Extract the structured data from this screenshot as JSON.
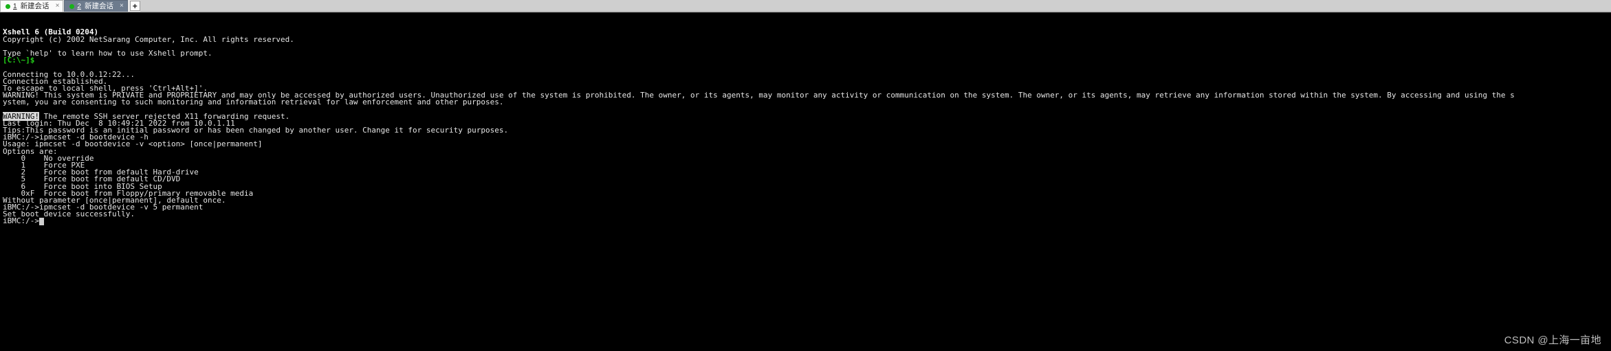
{
  "window": {
    "app_name": "Xshell 6"
  },
  "tabbar": {
    "tabs": [
      {
        "number": "1",
        "label": "新建会话",
        "close_icon": "×",
        "status_icon": "green-dot",
        "active": false
      },
      {
        "number": "2",
        "label": "新建会话",
        "close_icon": "×",
        "status_icon": "green-dot",
        "active": true
      }
    ],
    "new_tab_label": "+"
  },
  "terminal": {
    "lines": [
      {
        "text": "Xshell 6 (Build 0204)",
        "style": "bold"
      },
      {
        "text": "Copyright (c) 2002 NetSarang Computer, Inc. All rights reserved.",
        "style": "plain"
      },
      {
        "text": "",
        "style": "blank"
      },
      {
        "text": "Type `help' to learn how to use Xshell prompt.",
        "style": "plain"
      },
      {
        "text": "[C:\\~]$",
        "style": "green"
      },
      {
        "text": "",
        "style": "blank"
      },
      {
        "text": "Connecting to 10.0.0.12:22...",
        "style": "plain"
      },
      {
        "text": "Connection established.",
        "style": "plain"
      },
      {
        "text": "To escape to local shell, press 'Ctrl+Alt+]'.",
        "style": "plain"
      },
      {
        "text": "WARNING! This system is PRIVATE and PROPRIETARY and may only be accessed by authorized users. Unauthorized use of the system is prohibited. The owner, or its agents, may monitor any activity or communication on the system. The owner, or its agents, may retrieve any information stored within the system. By accessing and using the s",
        "style": "plain"
      },
      {
        "text": "ystem, you are consenting to such monitoring and information retrieval for law enforcement and other purposes.",
        "style": "plain"
      },
      {
        "text": "",
        "style": "blank"
      },
      {
        "text": "WARNING!",
        "style": "inverse-prefix",
        "rest": " The remote SSH server rejected X11 forwarding request."
      },
      {
        "text": "Last login: Thu Dec  8 10:49:21 2022 from 10.0.1.11",
        "style": "plain"
      },
      {
        "text": "Tips:This password is an initial password or has been changed by another user. Change it for security purposes.",
        "style": "plain"
      },
      {
        "text": "iBMC:/->ipmcset -d bootdevice -h",
        "style": "plain"
      },
      {
        "text": "Usage: ipmcset -d bootdevice -v <option> [once|permanent]",
        "style": "plain"
      },
      {
        "text": "Options are:",
        "style": "plain"
      },
      {
        "text": "    0    No override",
        "style": "plain"
      },
      {
        "text": "    1    Force PXE",
        "style": "plain"
      },
      {
        "text": "    2    Force boot from default Hard-drive",
        "style": "plain"
      },
      {
        "text": "    5    Force boot from default CD/DVD",
        "style": "plain"
      },
      {
        "text": "    6    Force boot into BIOS Setup",
        "style": "plain"
      },
      {
        "text": "    0xF  Force boot from Floppy/primary removable media",
        "style": "plain"
      },
      {
        "text": "Without parameter [once|permanent], default once.",
        "style": "plain"
      },
      {
        "text": "iBMC:/->ipmcset -d bootdevice -v 5 permanent",
        "style": "plain"
      },
      {
        "text": "Set boot device successfully.",
        "style": "plain"
      },
      {
        "text": "iBMC:/->",
        "style": "prompt-cursor"
      }
    ]
  },
  "watermark": {
    "text": "CSDN @上海一亩地"
  },
  "colors": {
    "terminal_background": "#000000",
    "terminal_foreground": "#e5e5e5",
    "prompt_green": "#23d018",
    "tab_active_background": "#6d7b8d",
    "tab_status_dot": "#18b218",
    "inverse_background": "#d8d8d8"
  }
}
